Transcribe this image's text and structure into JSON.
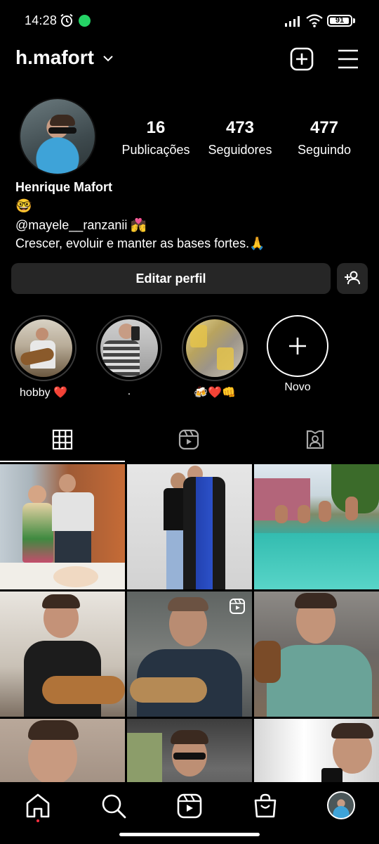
{
  "status_bar": {
    "time": "14:28",
    "battery": "91"
  },
  "header": {
    "username": "h.mafort"
  },
  "profile": {
    "stats": [
      {
        "value": "16",
        "label": "Publicações"
      },
      {
        "value": "473",
        "label": "Seguidores"
      },
      {
        "value": "477",
        "label": "Seguindo"
      }
    ],
    "name": "Henrique Mafort",
    "bio_emoji": "🤓",
    "bio_mention": "@mayele__ranzanii 💏",
    "bio_text": "Crescer, evoluir e manter as bases fortes.🙏",
    "edit_button": "Editar perfil"
  },
  "highlights": [
    {
      "label": "hobby ❤️"
    },
    {
      "label": "."
    },
    {
      "label": "🍻❤️👊"
    },
    {
      "label": "Novo"
    }
  ],
  "colors": {
    "background": "#000000",
    "button": "#262626",
    "text": "#ffffff",
    "notification_dot": "#ff3040"
  },
  "icons": {
    "tabs": [
      "grid-icon",
      "reels-icon",
      "tagged-icon"
    ],
    "nav": [
      "home-icon",
      "search-icon",
      "reels-icon",
      "shop-icon",
      "profile-avatar"
    ]
  }
}
